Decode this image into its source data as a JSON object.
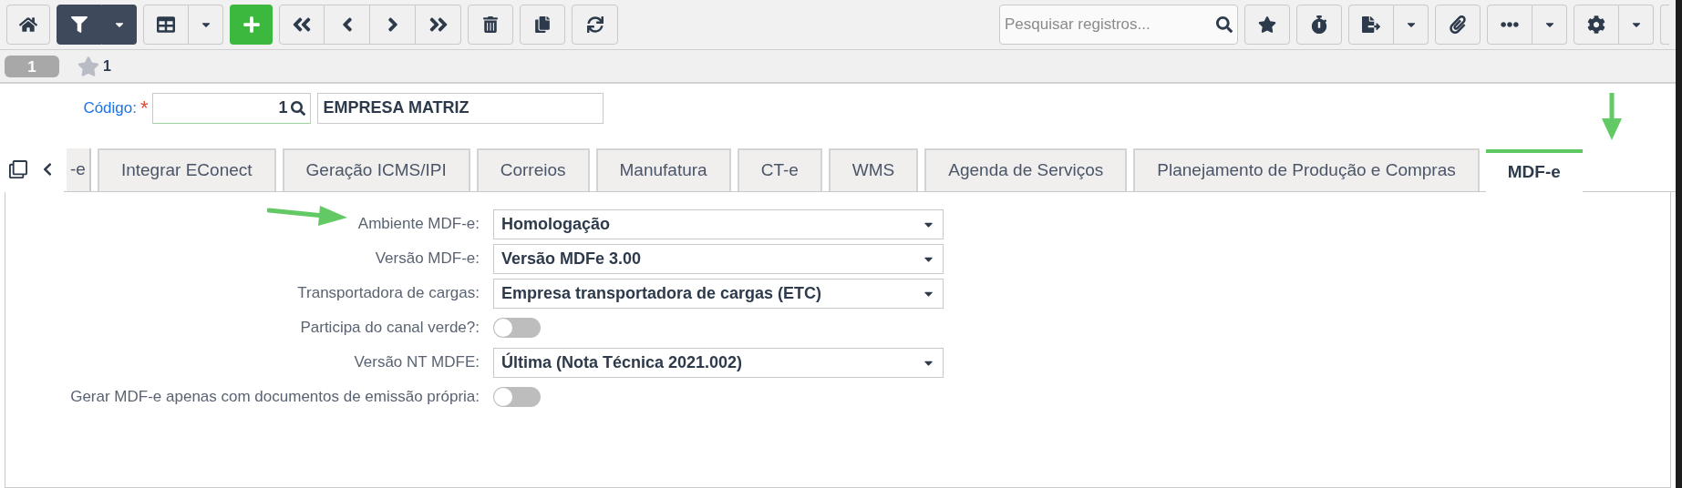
{
  "toolbar": {
    "filter": {
      "on": true
    },
    "search": {
      "placeholder": "Pesquisar registros..."
    }
  },
  "record_bar": {
    "record": {
      "label": "1",
      "selected": true
    },
    "favorites_count": "1"
  },
  "header": {
    "label": "Código:",
    "required_mark": "*",
    "code": "1",
    "name": "EMPRESA MATRIZ"
  },
  "tabs": [
    {
      "label": "-e",
      "selected": false
    },
    {
      "label": "Integrar EConect",
      "selected": false
    },
    {
      "label": "Geração ICMS/IPI",
      "selected": false
    },
    {
      "label": "Correios",
      "selected": false
    },
    {
      "label": "Manufatura",
      "selected": false
    },
    {
      "label": "CT-e",
      "selected": false
    },
    {
      "label": "WMS",
      "selected": false
    },
    {
      "label": "Agenda de Serviços",
      "selected": false
    },
    {
      "label": "Planejamento de Produção e Compras",
      "selected": false
    },
    {
      "label": "MDF-e",
      "selected": true
    }
  ],
  "fields": [
    {
      "kind": "select",
      "label": "Ambiente MDF-e:",
      "value": "Homologação"
    },
    {
      "kind": "select",
      "label": "Versão MDF-e:",
      "value": "Versão MDFe 3.00"
    },
    {
      "kind": "select",
      "label": "Transportadora de cargas:",
      "value": "Empresa transportadora de cargas (ETC)"
    },
    {
      "kind": "toggle",
      "label": "Participa do canal verde?:",
      "on": false
    },
    {
      "kind": "select",
      "label": "Versão NT MDFE:",
      "value": "Última (Nota Técnica 2021.002)"
    },
    {
      "kind": "toggle",
      "label": "Gerar MDF-e apenas com documentos de emissão própria:",
      "on": false
    }
  ]
}
